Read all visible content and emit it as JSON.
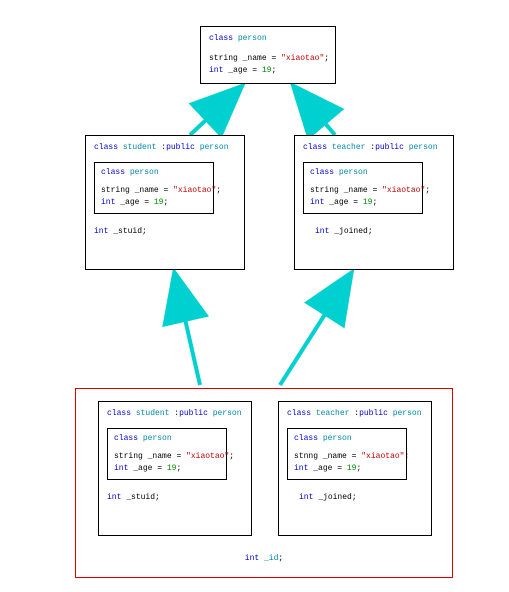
{
  "keywords": {
    "class": "class",
    "public": "public",
    "string": "string",
    "int": "int"
  },
  "classes": {
    "person": "person",
    "student": "student",
    "teacher": "teacher"
  },
  "values": {
    "name_str": "\"xiaotao\"",
    "age": "19"
  },
  "fields": {
    "name": "_name",
    "age": "_age",
    "stuid": "_stuid",
    "joined": "_joined",
    "id": "_id"
  },
  "strings": {
    "eq": " = ",
    "semi": ";",
    "colon": ":",
    "space": " ",
    "stnng": "stnng"
  }
}
